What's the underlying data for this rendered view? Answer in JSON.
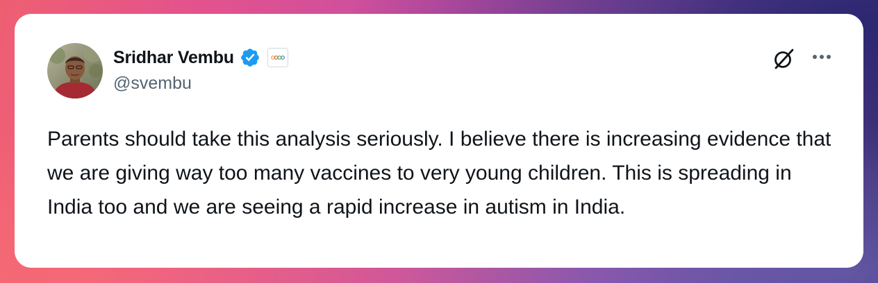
{
  "tweet": {
    "author": {
      "display_name": "Sridhar Vembu",
      "handle": "@svembu",
      "verified": true,
      "verified_icon": "verified-badge-icon",
      "affiliate_icon": "affiliate-badge-icon",
      "avatar_icon": "avatar-photo"
    },
    "text": "Parents should take this analysis seriously. I believe there is increasing evidence that we are giving way too many vaccines to very young children. This is spreading in India too and we are seeing a rapid increase in autism in India.",
    "actions": {
      "grok_icon": "grok-icon",
      "more_icon": "more-options-icon"
    }
  },
  "colors": {
    "text_primary": "#0f1419",
    "text_secondary": "#536471",
    "verified_blue": "#1d9bf0",
    "card_background": "#ffffff"
  }
}
